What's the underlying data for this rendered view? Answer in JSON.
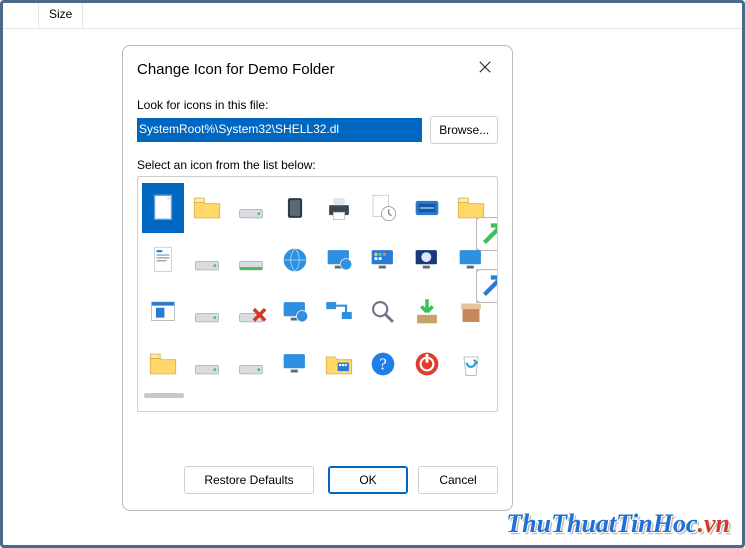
{
  "explorer": {
    "columns": {
      "size": "Size"
    }
  },
  "dialog": {
    "title": "Change Icon for Demo Folder",
    "look_label": "Look for icons in this file:",
    "path_value": "SystemRoot%\\System32\\SHELL32.dl",
    "browse_label": "Browse...",
    "select_label": "Select an icon from the list below:",
    "icons": [
      {
        "name": "blank-document",
        "selected": true
      },
      {
        "name": "folder"
      },
      {
        "name": "drive-local"
      },
      {
        "name": "chip"
      },
      {
        "name": "printer"
      },
      {
        "name": "recent-document"
      },
      {
        "name": "run-dialog"
      },
      {
        "name": "folder-shortcut-overlay",
        "overlay": "share"
      },
      {
        "name": "rtf-document"
      },
      {
        "name": "drive-removable"
      },
      {
        "name": "drive-green"
      },
      {
        "name": "globe"
      },
      {
        "name": "monitor-globe"
      },
      {
        "name": "control-panel"
      },
      {
        "name": "power-saver-monitor"
      },
      {
        "name": "monitor-shortcut-overlay",
        "overlay": "shortcut"
      },
      {
        "name": "window-page"
      },
      {
        "name": "drive-stack"
      },
      {
        "name": "drive-error"
      },
      {
        "name": "monitor-network"
      },
      {
        "name": "network-map"
      },
      {
        "name": "magnifier"
      },
      {
        "name": "install"
      },
      {
        "name": "box"
      },
      {
        "name": "folder-plain"
      },
      {
        "name": "drive-dark"
      },
      {
        "name": "drive-dot"
      },
      {
        "name": "monitor-blank"
      },
      {
        "name": "folder-programs"
      },
      {
        "name": "help"
      },
      {
        "name": "shutdown"
      },
      {
        "name": "recycle-bin"
      }
    ],
    "restore_label": "Restore Defaults",
    "ok_label": "OK",
    "cancel_label": "Cancel"
  },
  "watermark": {
    "brand": "ThuThuatTinHoc",
    "tld": ".vn"
  },
  "colors": {
    "accent": "#0067c0",
    "danger": "#d63a2a"
  }
}
